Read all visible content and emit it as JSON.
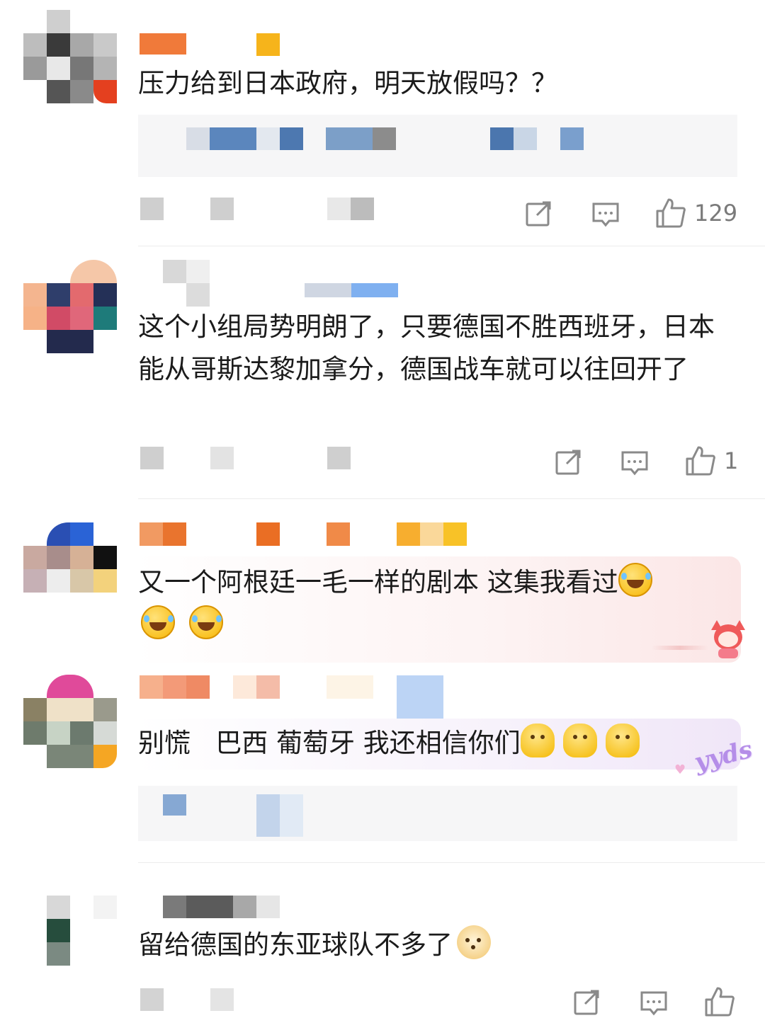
{
  "comments": [
    {
      "text": "压力给到日本政府，明天放假吗？？",
      "likes": "129",
      "has_reply_preview": true
    },
    {
      "text": "这个小组局势明朗了，只要德国不胜西班牙，日本能从哥斯达黎加拿分，德国战车就可以往回开了",
      "likes": "1",
      "has_reply_preview": false
    },
    {
      "text": "又一个阿根廷一毛一样的剧本 这集我看过",
      "emojis": [
        "laughing-crying-emoji",
        "laughing-crying-emoji",
        "laughing-crying-emoji"
      ],
      "has_reply_preview": false
    },
    {
      "text": "别慌   巴西 葡萄牙 我还相信你们",
      "emojis": [
        "melting-face-emoji",
        "melting-face-emoji",
        "melting-face-emoji"
      ],
      "badge": "yyds",
      "has_reply_preview": true
    },
    {
      "text": "留给德国的东亚球队不多了",
      "emojis": [
        "doge-emoji"
      ],
      "likes": "",
      "has_reply_preview": false
    }
  ],
  "icons": {
    "share": "share-icon",
    "reply": "comment-icon",
    "like": "thumbs-up-icon"
  },
  "colors": {
    "text": "#1b1b1b",
    "meta": "#7a7a7a",
    "reply_bg": "#f6f6f7",
    "divider": "#ececec"
  }
}
